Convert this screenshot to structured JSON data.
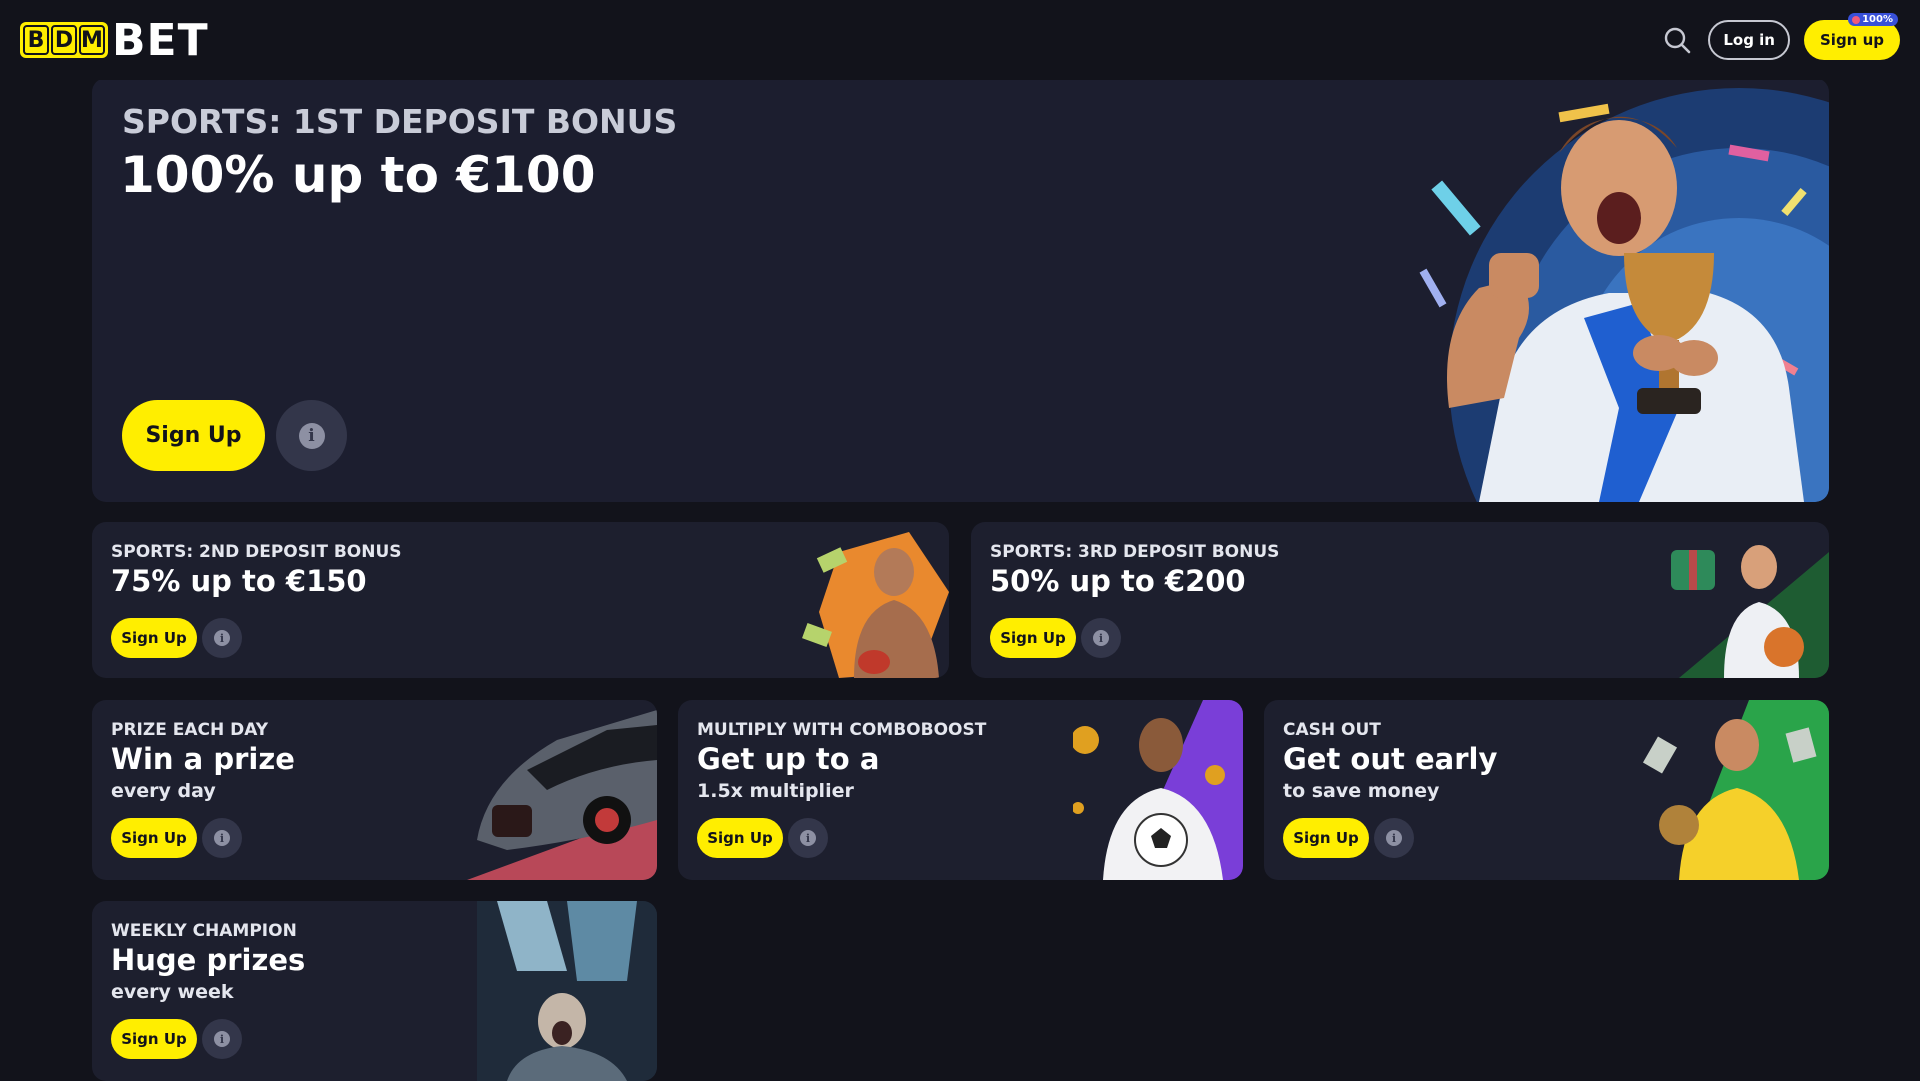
{
  "header": {
    "logo_letters": [
      "B",
      "D",
      "M"
    ],
    "logo_word": "BET",
    "search_icon": "search-icon",
    "login_label": "Log in",
    "signup_label": "Sign up",
    "signup_badge": "100%"
  },
  "hero": {
    "kicker": "SPORTS: 1ST DEPOSIT BONUS",
    "headline": "100% up to €100",
    "button_label": "Sign Up",
    "info_icon": "info-icon"
  },
  "promos": [
    {
      "kicker": "SPORTS: 2ND DEPOSIT BONUS",
      "headline": "75% up to €150",
      "sub": "",
      "button_label": "Sign Up"
    },
    {
      "kicker": "SPORTS: 3RD DEPOSIT BONUS",
      "headline": "50% up to €200",
      "sub": "",
      "button_label": "Sign Up"
    },
    {
      "kicker": "PRIZE EACH DAY",
      "headline": "Win a prize",
      "sub": "every day",
      "button_label": "Sign Up"
    },
    {
      "kicker": "MULTIPLY WITH COMBOBOOST",
      "headline": "Get up to a",
      "sub": "1.5x multiplier",
      "button_label": "Sign Up"
    },
    {
      "kicker": "CASH OUT",
      "headline": "Get out early",
      "sub": "to save money",
      "button_label": "Sign Up"
    },
    {
      "kicker": "WEEKLY CHAMPION",
      "headline": "Huge prizes",
      "sub": "every week",
      "button_label": "Sign Up"
    }
  ],
  "colors": {
    "background": "#12131b",
    "card": "#1d1f2e",
    "accent_yellow": "#ffee00",
    "info_button": "#33364a"
  }
}
